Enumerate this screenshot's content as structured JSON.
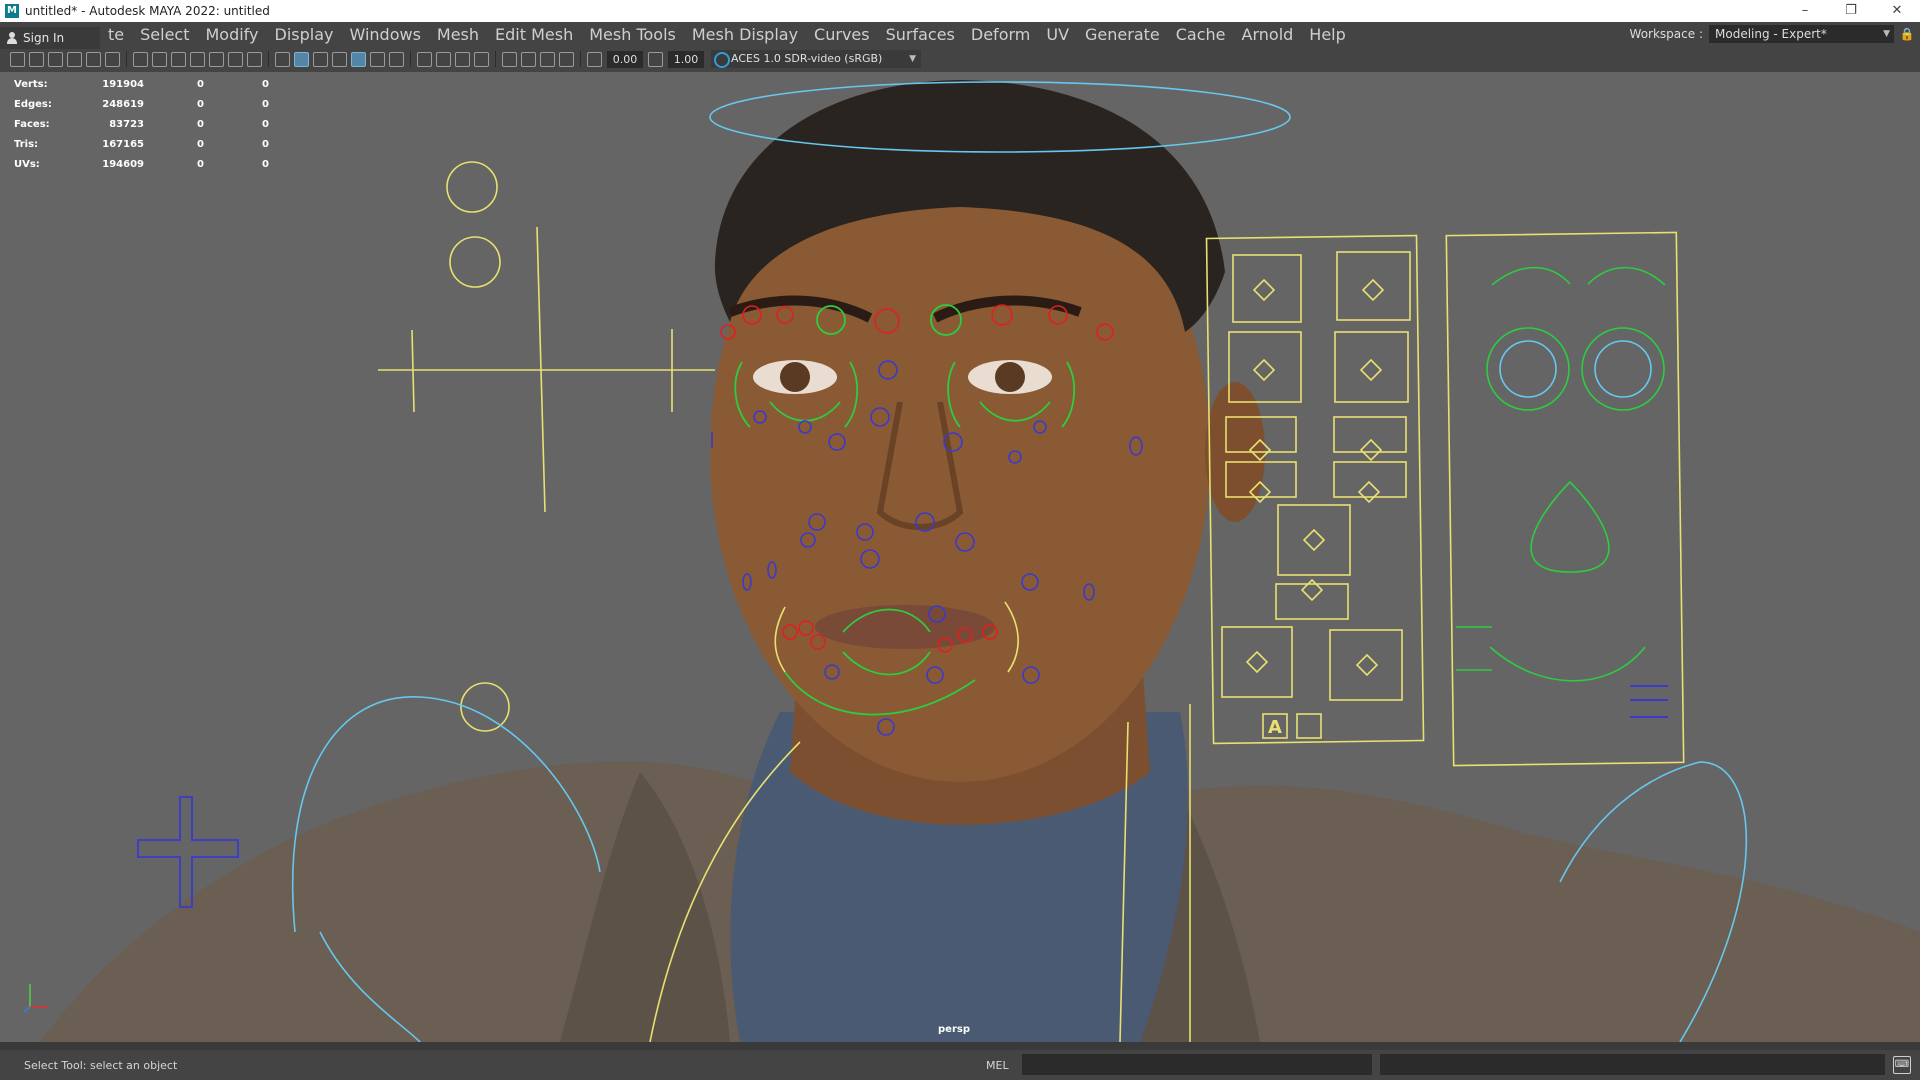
{
  "window": {
    "title": "untitled* - Autodesk MAYA 2022: untitled",
    "logo_letter": "M",
    "controls": [
      "–",
      "❐",
      "✕"
    ]
  },
  "menubar": {
    "sign_in": "Sign In",
    "partial_item": "te",
    "items": [
      "Select",
      "Modify",
      "Display",
      "Windows",
      "Mesh",
      "Edit Mesh",
      "Mesh Tools",
      "Mesh Display",
      "Curves",
      "Surfaces",
      "Deform",
      "UV",
      "Generate",
      "Cache",
      "Arnold",
      "Help"
    ],
    "workspace_label": "Workspace :",
    "workspace_value": "Modeling - Expert*"
  },
  "toolbar": {
    "exposure": "0.00",
    "gamma": "1.00",
    "color_space": "ACES 1.0 SDR-video (sRGB)"
  },
  "hud": {
    "rows": [
      {
        "label": "Verts:",
        "v1": "191904",
        "v2": "0",
        "v3": "0"
      },
      {
        "label": "Edges:",
        "v1": "248619",
        "v2": "0",
        "v3": "0"
      },
      {
        "label": "Faces:",
        "v1": "83723",
        "v2": "0",
        "v3": "0"
      },
      {
        "label": "Tris:",
        "v1": "167165",
        "v2": "0",
        "v3": "0"
      },
      {
        "label": "UVs:",
        "v1": "194609",
        "v2": "0",
        "v3": "0"
      }
    ]
  },
  "viewport": {
    "camera": "persp",
    "panel_letter": "A",
    "colors": {
      "skin": "#8a5a35",
      "jacket": "#6b5e53",
      "shirt": "#4a5a72",
      "hair": "#2a2420",
      "ctrl_red": "#e02020",
      "ctrl_green": "#2ecc40",
      "ctrl_blue": "#3a3acc",
      "ctrl_yellow": "#e8e070",
      "ctrl_cyan": "#66c8ee"
    }
  },
  "status": {
    "message": "Select Tool: select an object",
    "language": "MEL"
  }
}
